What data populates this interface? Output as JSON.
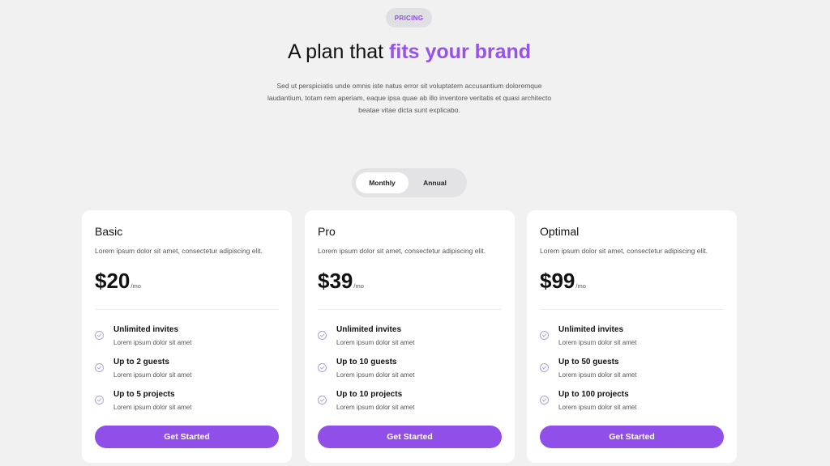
{
  "badge": "PRICING",
  "headline": {
    "prefix": "A plan that ",
    "accent": "fits your brand"
  },
  "subtext": "Sed ut perspiciatis unde omnis iste natus error sit voluptatem accusantium doloremque laudantium, totam rem aperiam, eaque ipsa quae ab illo inventore veritatis et quasi architecto beatae vitae dicta sunt explicabo.",
  "billing_toggle": {
    "options": [
      "Monthly",
      "Annual"
    ],
    "selected": "Monthly"
  },
  "colors": {
    "accent": "#9653ea",
    "button": "#8f4fe8",
    "background": "#f1f1f2",
    "check": "#a9a6d6"
  },
  "plans": [
    {
      "name": "Basic",
      "description": "Lorem ipsum dolor sit amet, consectetur adipiscing elit.",
      "price": "$20",
      "unit": "/mo",
      "features": [
        {
          "title": "Unlimited invites",
          "sub": "Lorem ipsum dolor sit amet",
          "icon": "check-circle-icon"
        },
        {
          "title": "Up to 2 guests",
          "sub": "Lorem ipsum dolor sit amet",
          "icon": "check-circle-icon"
        },
        {
          "title": "Up to 5 projects",
          "sub": "Lorem ipsum dolor sit amet",
          "icon": "check-circle-icon"
        }
      ],
      "cta": "Get Started"
    },
    {
      "name": "Pro",
      "description": "Lorem ipsum dolor sit amet, consectetur adipiscing elit.",
      "price": "$39",
      "unit": "/mo",
      "features": [
        {
          "title": "Unlimited invites",
          "sub": "Lorem ipsum dolor sit amet",
          "icon": "check-circle-icon"
        },
        {
          "title": "Up to 10 guests",
          "sub": "Lorem ipsum dolor sit amet",
          "icon": "check-circle-icon"
        },
        {
          "title": "Up to 10 projects",
          "sub": "Lorem ipsum dolor sit amet",
          "icon": "check-circle-icon"
        }
      ],
      "cta": "Get Started"
    },
    {
      "name": "Optimal",
      "description": "Lorem ipsum dolor sit amet, consectetur adipiscing elit.",
      "price": "$99",
      "unit": "/mo",
      "features": [
        {
          "title": "Unlimited invites",
          "sub": "Lorem ipsum dolor sit amet",
          "icon": "check-circle-icon"
        },
        {
          "title": "Up to 50 guests",
          "sub": "Lorem ipsum dolor sit amet",
          "icon": "check-circle-icon"
        },
        {
          "title": "Up to 100 projects",
          "sub": "Lorem ipsum dolor sit amet",
          "icon": "check-circle-icon"
        }
      ],
      "cta": "Get Started"
    }
  ]
}
